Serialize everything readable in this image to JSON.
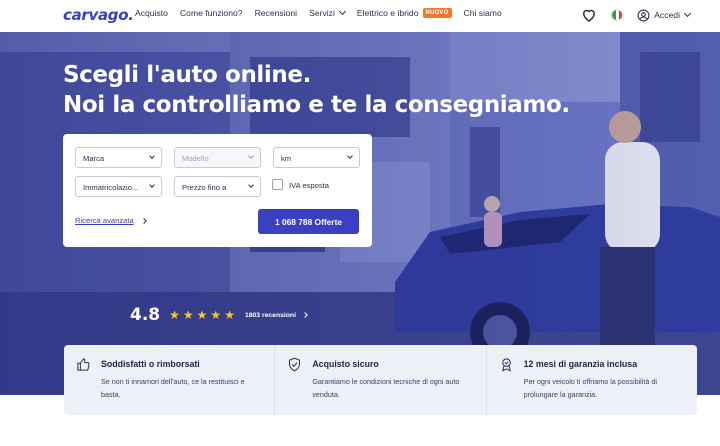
{
  "brand": {
    "logo": "carvago."
  },
  "nav": {
    "items": [
      {
        "label": "Acquisto"
      },
      {
        "label": "Come funziono?"
      },
      {
        "label": "Recensioni"
      },
      {
        "label": "Servizi"
      },
      {
        "label": "Elettrico e ibrido",
        "badge": "NUOVO"
      },
      {
        "label": "Chi siamo"
      }
    ],
    "account": "Accedi"
  },
  "hero": {
    "line1": "Scegli l'auto online.",
    "line2": "Noi la controlliamo e te la consegniamo."
  },
  "search": {
    "brand": "Marca",
    "model": "Modello",
    "km": "km",
    "registration": "Immatricolazio...",
    "price": "Prezzo fino a",
    "vat": "IVA esposta",
    "advanced": "Ricerca avanzata",
    "cta": "1 068 788 Offerte"
  },
  "rating": {
    "value": "4.8",
    "stars": 5,
    "reviews": "1803 recensioni"
  },
  "features": [
    {
      "icon": "thumb-up-icon",
      "title": "Soddisfatti o rimborsati",
      "text": "Se non ti innamori dell'auto, ce la restituisci e basta."
    },
    {
      "icon": "shield-check-icon",
      "title": "Acquisto sicuro",
      "text": "Garantiamo le condizioni tecniche di ogni auto venduta."
    },
    {
      "icon": "award-badge-icon",
      "title": "12 mesi di garanzia inclusa",
      "text": "Per ogni veicolo ti offriamo la possibilità di prolungare la garanzia."
    }
  ],
  "colors": {
    "primary": "#3b3fc1",
    "badge": "#ef7a2d",
    "star": "#f7c436"
  }
}
